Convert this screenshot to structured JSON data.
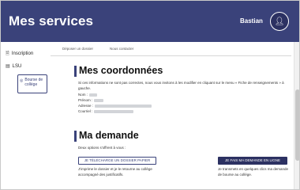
{
  "header": {
    "title": "Mes services",
    "username": "Bastian",
    "avatar_icon": "user-icon"
  },
  "sidebar": {
    "items": [
      {
        "label": "Inscription",
        "icon": "document-icon"
      },
      {
        "label": "LSU",
        "icon": "book-icon"
      },
      {
        "label": "Bourse de collège",
        "icon": "coins-icon",
        "active": true
      }
    ]
  },
  "tabs": [
    {
      "label": "Déposer un dossier"
    },
    {
      "label": "Nous contacter"
    }
  ],
  "coordonnees": {
    "title": "Mes coordonnées",
    "intro": "Si ces informations ne sont pas correctes, nous vous invitons à les modifier en cliquant sur le menu « Fiche de renseignements » à gauche.",
    "fields": [
      {
        "label": "Nom :"
      },
      {
        "label": "Prénom :"
      },
      {
        "label": "Adresse :"
      },
      {
        "label": "Courriel :"
      }
    ]
  },
  "demande": {
    "title": "Ma demande",
    "options_text": "Deux options s'offrent à vous :",
    "paper_button": "JE TÉLÉCHARGE UN DOSSIER PAPIER",
    "online_button": "JE FAIS MA DEMANDE EN LIGNE",
    "paper_desc": "J'imprime le dossier et je le retourne au collège accompagné des justificatifs.",
    "online_desc": "Je transmets en quelques clics ma demande de bourse au collège."
  },
  "colors": {
    "header_bg": "#3a427a",
    "accent": "#3a427a",
    "primary_button": "#2c3162"
  }
}
